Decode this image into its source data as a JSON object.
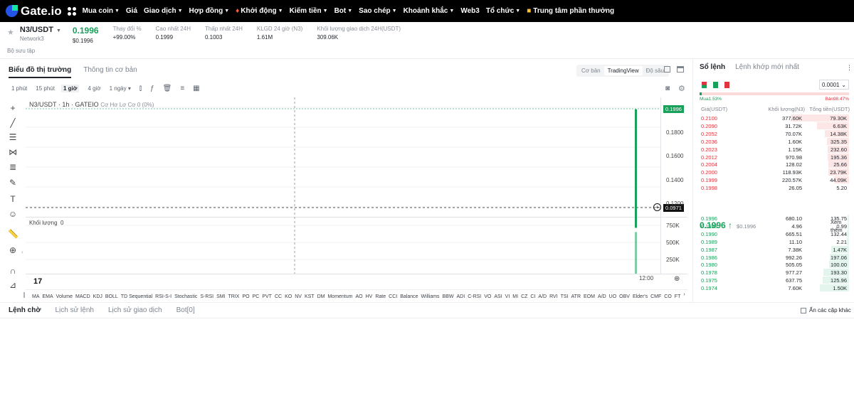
{
  "nav": {
    "logo": "Gate.io",
    "items": [
      "Mua coin",
      "Giá",
      "Giao dịch",
      "Hợp đồng",
      "Khởi động",
      "Kiếm tiền",
      "Bot",
      "Sao chép",
      "Khoảnh khắc",
      "Web3",
      "Tổ chức"
    ],
    "rewards": "Trung tâm phần thưởng"
  },
  "ticker": {
    "pair": "N3/USDT",
    "network": "Network3",
    "price": "0.1996",
    "price_usd": "$0.1996",
    "change_label": "Thay đổi %",
    "change_value": "+99.00%",
    "high_label": "Cao nhất 24H",
    "high_value": "0.1999",
    "low_label": "Thấp nhất 24H",
    "low_value": "0.1003",
    "vol_n3_label": "KLGD 24 giờ (N3)",
    "vol_n3_value": "1.61M",
    "vol_usdt_label": "Khối lượng giao dịch 24H(USDT)",
    "vol_usdt_value": "309.06K"
  },
  "favorites": "Bộ sưu tập",
  "chart_tabs": {
    "market": "Biểu đồ thị trường",
    "info": "Thông tin cơ bản"
  },
  "view_modes": {
    "basic": "Cơ bản",
    "tradingview": "TradingView",
    "depth": "Độ sâu"
  },
  "intervals": [
    "1 phút",
    "15 phút",
    "1 giờ",
    "4 giờ",
    "1 ngày"
  ],
  "chart": {
    "title": "N3/USDT · 1h · GATEIO",
    "ohlc": "Cơ Hơ Lơ Cơ 0 (0%)",
    "volume_label": "Khối lượng",
    "volume_value": "0",
    "last_price_tag": "0.1996",
    "crosshair_tag": "0.0971",
    "time_label": "12:00",
    "tv_logo": "17"
  },
  "chart_data": {
    "type": "bar",
    "x": [
      "12:00"
    ],
    "price_axis_ticks": [
      "0.1800",
      "0.1600",
      "0.1400",
      "0.1200"
    ],
    "price_ylim": [
      0.1,
      0.2
    ],
    "candle": {
      "open": 0.1003,
      "close": 0.1996,
      "high": 0.1999,
      "low": 0.1003
    },
    "volume_axis_ticks": [
      "750K",
      "500K",
      "250K"
    ],
    "volume_ylim": [
      0,
      1000000
    ],
    "volume_value": 750000,
    "up_color": "#19a05b"
  },
  "indicators": [
    "MA",
    "EMA",
    "Volume",
    "MACD",
    "KDJ",
    "BOLL",
    "TD Sequential",
    "RSI-S-I",
    "Stochastic",
    "S-RSI",
    "SMI",
    "TRIX",
    "PO",
    "PC",
    "PVT",
    "CC",
    "KO",
    "NV",
    "KST",
    "DM",
    "Momentum",
    "AO",
    "HV",
    "Rate",
    "CCI",
    "Balance",
    "Williams",
    "BBW",
    "ADI",
    "C-RSI",
    "VO",
    "ASI",
    "VI",
    "MI",
    "CZ",
    "CI",
    "A/D",
    "RVI",
    "TSI",
    "ATR",
    "EOM",
    "A/D",
    "UO",
    "OBV",
    "Elder's",
    "CMF",
    "CO",
    "FT"
  ],
  "order_tabs": [
    "Lệnh chờ",
    "Lịch sử lệnh",
    "Lịch sử giao dịch",
    "Bot[0]"
  ],
  "hide_pairs": "Ẩn các cặp khác",
  "orderbook": {
    "tabs": [
      "Sổ lệnh",
      "Lệnh khớp mới nhất"
    ],
    "precision": "0.0001",
    "buy_ratio_label": "Mua1.53%",
    "sell_ratio_label": "Bán98.47%",
    "buy_ratio": 0.0153,
    "headers": [
      "Giá(USDT)",
      "Khối lượng(N3)",
      "Tổng tiền(USDT)"
    ],
    "asks": [
      {
        "p": "0.2100",
        "q": "377.60K",
        "t": "79.30K",
        "d": 1.0
      },
      {
        "p": "0.2090",
        "q": "31.72K",
        "t": "6.63K",
        "d": 0.55
      },
      {
        "p": "0.2052",
        "q": "70.07K",
        "t": "14.38K",
        "d": 0.42
      },
      {
        "p": "0.2036",
        "q": "1.60K",
        "t": "325.35",
        "d": 0.38
      },
      {
        "p": "0.2023",
        "q": "1.15K",
        "t": "232.60",
        "d": 0.37
      },
      {
        "p": "0.2012",
        "q": "970.98",
        "t": "195.36",
        "d": 0.36
      },
      {
        "p": "0.2004",
        "q": "128.02",
        "t": "25.66",
        "d": 0.35
      },
      {
        "p": "0.2000",
        "q": "118.93K",
        "t": "23.79K",
        "d": 0.35
      },
      {
        "p": "0.1999",
        "q": "220.57K",
        "t": "44.09K",
        "d": 0.26
      },
      {
        "p": "0.1998",
        "q": "26.05",
        "t": "5.20",
        "d": 0.0
      }
    ],
    "mid_price": "0.1996 ↑",
    "mid_usd": "$0.1996",
    "more_label_1": "Xem",
    "more_label_2": "thêm",
    "bids": [
      {
        "p": "0.1996",
        "q": "680.10",
        "t": "135.75",
        "d": 0.03
      },
      {
        "p": "0.1993",
        "q": "4.96",
        "t": "0.99",
        "d": 0.03
      },
      {
        "p": "0.1990",
        "q": "665.51",
        "t": "132.44",
        "d": 0.04
      },
      {
        "p": "0.1989",
        "q": "11.10",
        "t": "2.21",
        "d": 0.04
      },
      {
        "p": "0.1987",
        "q": "7.38K",
        "t": "1.47K",
        "d": 0.3
      },
      {
        "p": "0.1986",
        "q": "992.26",
        "t": "197.06",
        "d": 0.33
      },
      {
        "p": "0.1980",
        "q": "505.05",
        "t": "100.00",
        "d": 0.34
      },
      {
        "p": "0.1978",
        "q": "977.27",
        "t": "193.30",
        "d": 0.44
      },
      {
        "p": "0.1975",
        "q": "637.75",
        "t": "125.96",
        "d": 0.45
      },
      {
        "p": "0.1974",
        "q": "7.60K",
        "t": "1.50K",
        "d": 0.5
      }
    ]
  }
}
